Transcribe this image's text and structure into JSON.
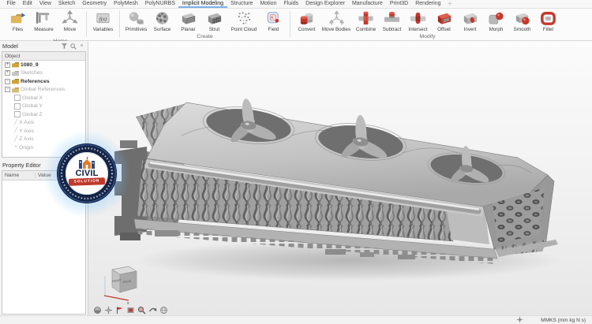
{
  "menubar": {
    "items": [
      "File",
      "Edit",
      "View",
      "Sketch",
      "Geometry",
      "PolyMesh",
      "PolyNURBS",
      "Implicit Modeling",
      "Structure",
      "Motion",
      "Fluids",
      "Design Explorer",
      "Manufacture",
      "Print3D",
      "Rendering"
    ],
    "active_item": "Implicit Modeling"
  },
  "ribbon": {
    "groups": [
      {
        "label": "Home",
        "buttons": [
          {
            "label": "Files"
          },
          {
            "label": "Measure"
          },
          {
            "label": "Move"
          },
          {
            "label": "Variables"
          }
        ]
      },
      {
        "label": "Create",
        "buttons": [
          {
            "label": "Primitives"
          },
          {
            "label": "Surface"
          },
          {
            "label": "Planar"
          },
          {
            "label": "Strut"
          },
          {
            "label": "Point Cloud"
          },
          {
            "label": "Field"
          }
        ]
      },
      {
        "label": "Modify",
        "buttons": [
          {
            "label": "Convert"
          },
          {
            "label": "Move Bodies"
          },
          {
            "label": "Combine"
          },
          {
            "label": "Subtract"
          },
          {
            "label": "Intersect"
          },
          {
            "label": "Offset"
          },
          {
            "label": "Invert"
          },
          {
            "label": "Morph"
          },
          {
            "label": "Smooth"
          },
          {
            "label": "Fillet"
          }
        ]
      }
    ]
  },
  "model_panel": {
    "title": "Model",
    "list_header": "Object",
    "items": [
      {
        "label": "1080_9"
      },
      {
        "label": "Sketches"
      },
      {
        "label": "References"
      },
      {
        "label": "Global References"
      },
      {
        "label": "Global X"
      },
      {
        "label": "Global Y"
      },
      {
        "label": "Global Z"
      },
      {
        "label": "X Axis"
      },
      {
        "label": "Y Axis"
      },
      {
        "label": "Z Axis"
      },
      {
        "label": "Origin"
      }
    ]
  },
  "property_editor": {
    "title": "Property Editor",
    "columns": {
      "name": "Name",
      "value": "Value"
    }
  },
  "watermark": {
    "title": "CIVIL",
    "subtitle": "SOLUTION"
  },
  "viewcube": {
    "face_left": "RIGHT",
    "face_right": "REAR",
    "axis_x": "x"
  },
  "statusbar": {
    "units": "MMKS (mm kg N s)"
  },
  "colors": {
    "accent_blue": "#7ab1e8",
    "icon_red": "#c4392e",
    "logo_navy": "#142447",
    "logo_red": "#c0392b",
    "glow_blue": "#76c2ff"
  }
}
